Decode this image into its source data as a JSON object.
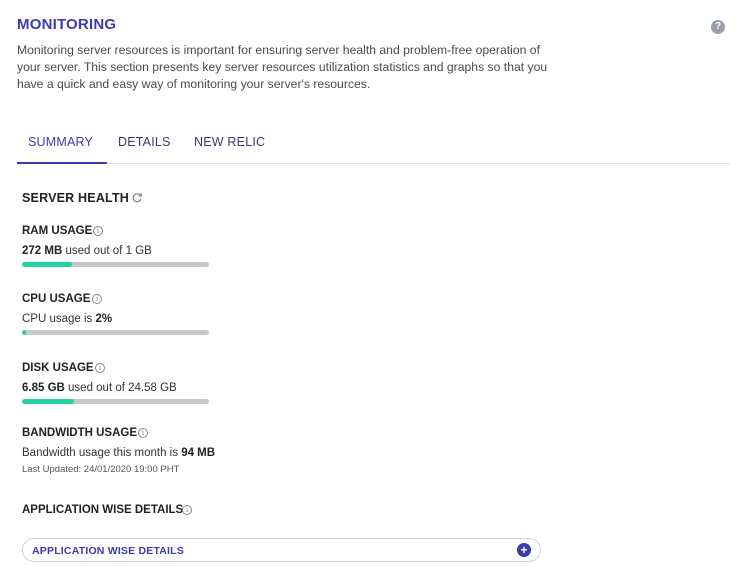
{
  "header": {
    "title": "MONITORING",
    "description": "Monitoring server resources is important for ensuring server health and problem-free operation of your server. This section presents key server resources utilization statistics and graphs so that you have a quick and easy way of monitoring your server's resources."
  },
  "tabs": [
    {
      "label": "SUMMARY",
      "active": true
    },
    {
      "label": "DETAILS",
      "active": false
    },
    {
      "label": "NEW RELIC",
      "active": false
    }
  ],
  "server_health": {
    "title": "SERVER HEALTH",
    "ram": {
      "label": "RAM USAGE",
      "value": "272 MB",
      "text_suffix": " used out of 1 GB",
      "fill_fraction": 0.27
    },
    "cpu": {
      "label": "CPU USAGE",
      "text_prefix": "CPU usage is ",
      "value": "2%",
      "fill_fraction": 0.02
    },
    "disk": {
      "label": "DISK USAGE",
      "value": "6.85 GB",
      "text_suffix": " used out of 24.58 GB",
      "fill_fraction": 0.28
    },
    "bandwidth": {
      "label": "BANDWIDTH USAGE",
      "text_prefix": "Bandwidth usage this month is ",
      "value": "94 MB",
      "last_updated": "Last Updated: 24/01/2020 19:00 PHT"
    }
  },
  "application_wise": {
    "title": "APPLICATION WISE DETAILS",
    "button_label": "APPLICATION WISE DETAILS"
  },
  "colors": {
    "accent": "#3b3bb0",
    "bar_fill": "#22d3a2",
    "bar_track": "#c8c8c8"
  },
  "icons": {
    "help": "question-circle-icon",
    "refresh": "refresh-icon",
    "info": "info-circle-icon",
    "plus": "plus-circle-icon"
  }
}
